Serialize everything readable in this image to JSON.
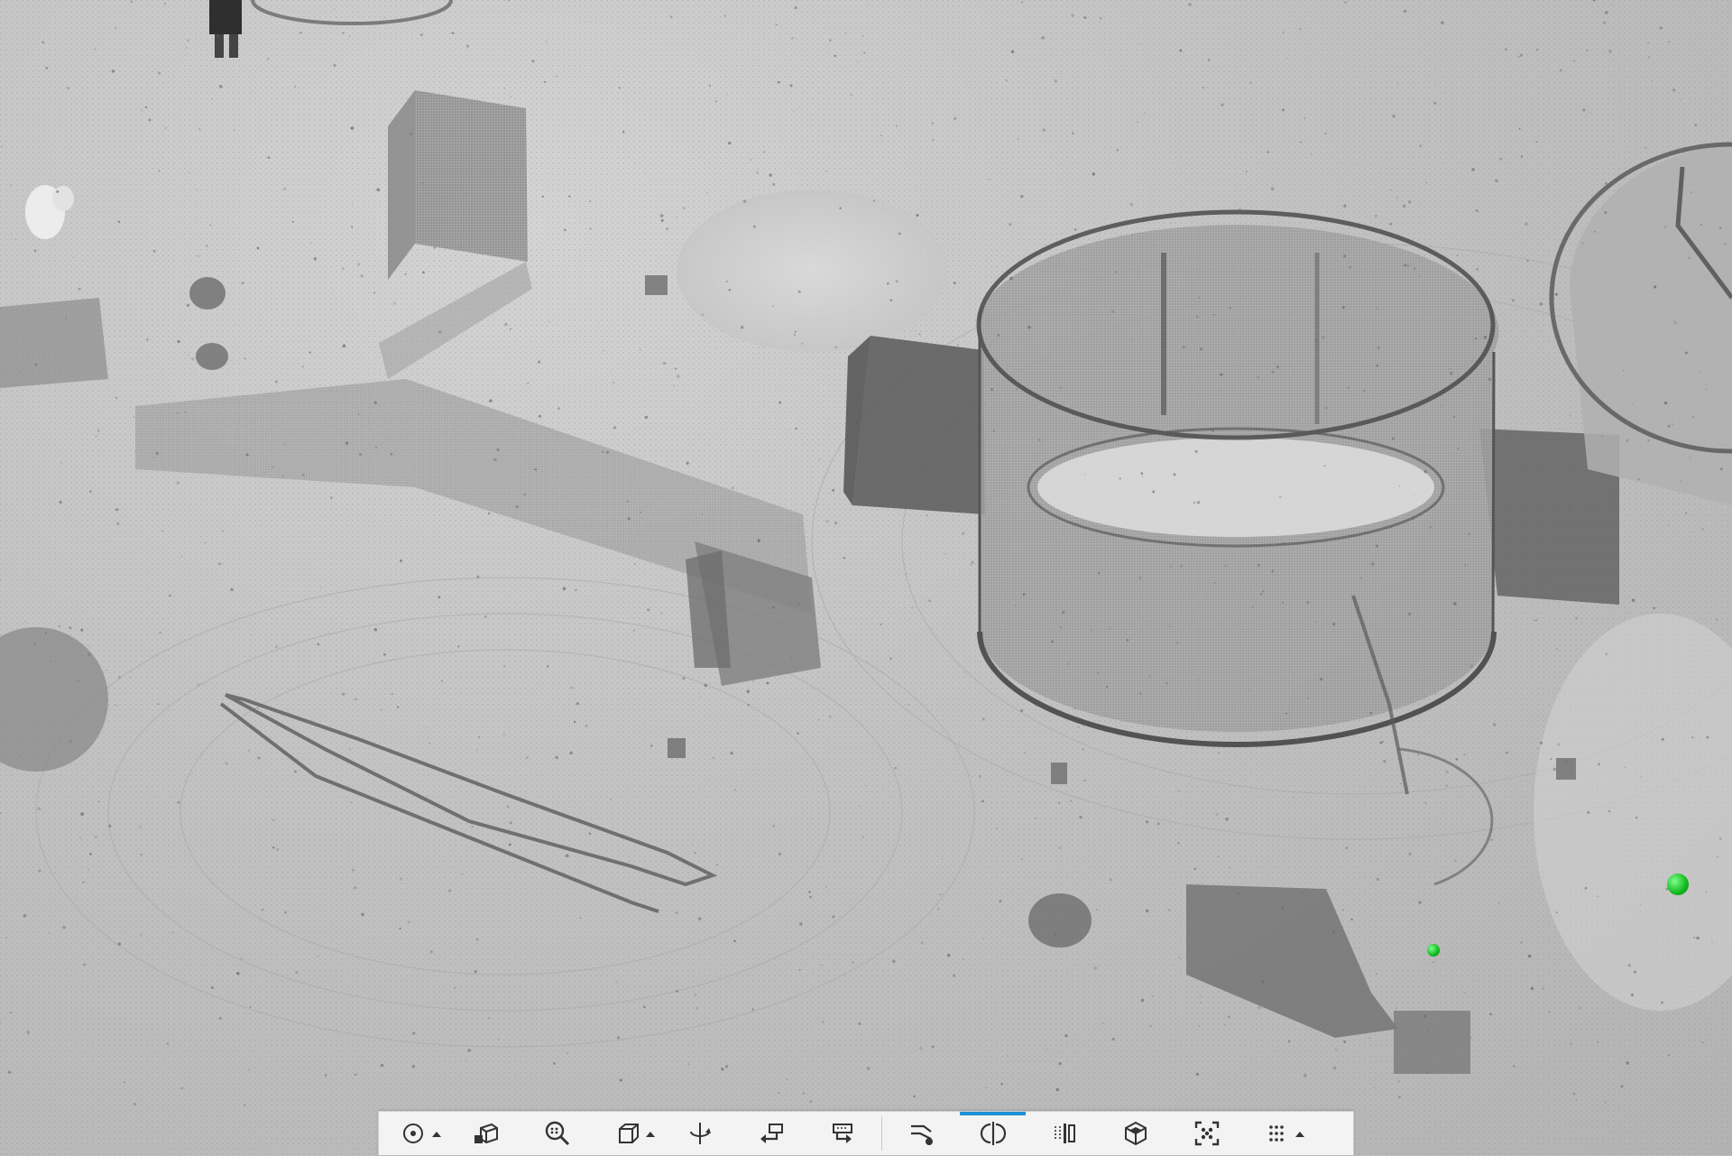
{
  "app": {
    "view": "point-cloud-3d",
    "accent_color": "#1e90d6",
    "marker_color": "#1fc22d",
    "background_tone": "#bdbdbd"
  },
  "toolbar": {
    "active_button": "section-view",
    "buttons": [
      {
        "id": "orbit-center",
        "icon": "target-circle-icon",
        "has_dropdown": true
      },
      {
        "id": "zoom-extents",
        "icon": "cube-zoom-icon",
        "has_dropdown": false
      },
      {
        "id": "zoom-region",
        "icon": "magnifier-icon",
        "has_dropdown": false
      },
      {
        "id": "view-presets",
        "icon": "cube-outline-icon",
        "has_dropdown": true
      },
      {
        "id": "rotate-axis",
        "icon": "rotate-axis-icon",
        "has_dropdown": false
      },
      {
        "id": "undo-view",
        "icon": "undo-view-icon",
        "has_dropdown": false
      },
      {
        "id": "redo-view",
        "icon": "redo-view-icon",
        "has_dropdown": false
      },
      {
        "id": "clip-tool",
        "icon": "clip-tool-icon",
        "has_dropdown": false
      },
      {
        "id": "section-view",
        "icon": "section-view-icon",
        "has_dropdown": false
      },
      {
        "id": "slice-view",
        "icon": "slice-view-icon",
        "has_dropdown": false
      },
      {
        "id": "box-view",
        "icon": "box-3d-icon",
        "has_dropdown": false
      },
      {
        "id": "fit-points",
        "icon": "fit-points-icon",
        "has_dropdown": false
      },
      {
        "id": "more-tools",
        "icon": "grid-dots-icon",
        "has_dropdown": true
      }
    ]
  }
}
